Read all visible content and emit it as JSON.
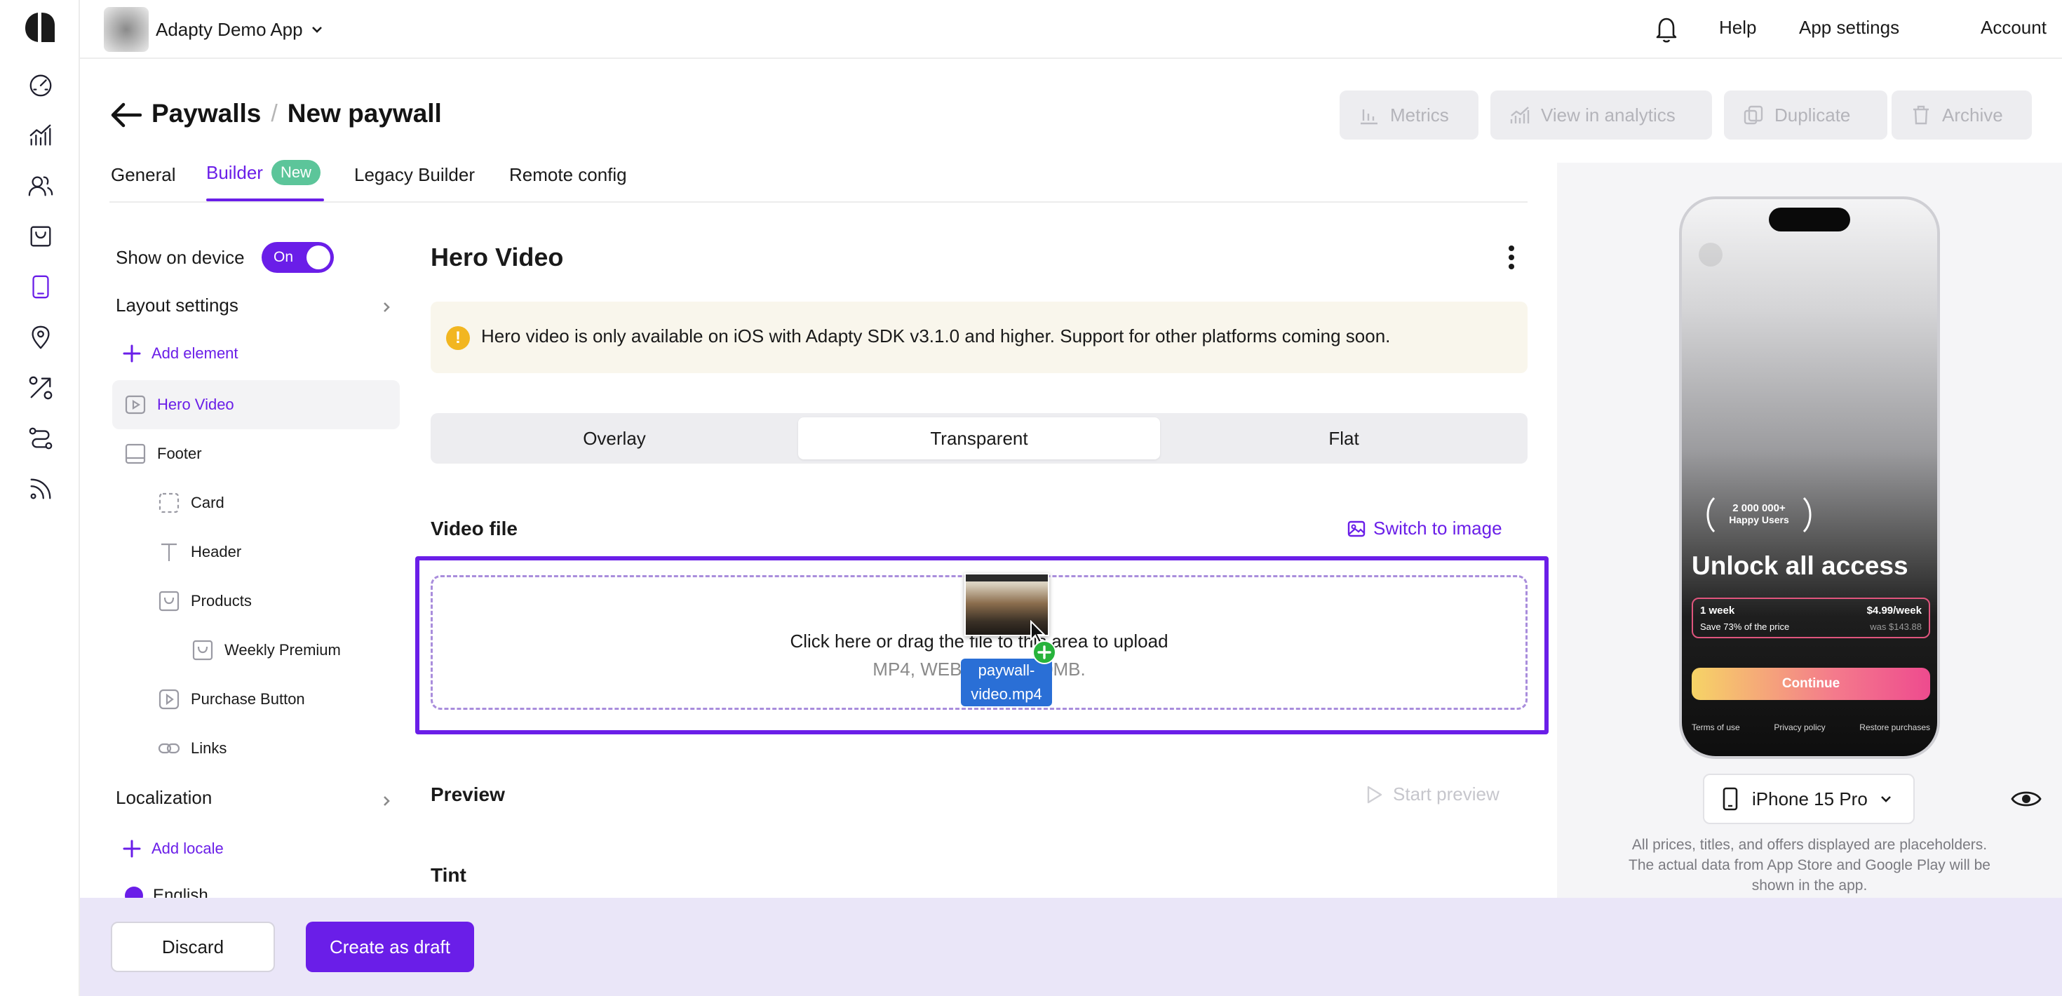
{
  "app": {
    "name": "Adapty Demo App"
  },
  "topbar": {
    "help": "Help",
    "app_settings": "App settings",
    "account": "Account"
  },
  "header": {
    "breadcrumb_root": "Paywalls",
    "separator": "/",
    "title": "New paywall",
    "actions": {
      "metrics": "Metrics",
      "view_analytics": "View in analytics",
      "duplicate": "Duplicate",
      "archive": "Archive"
    }
  },
  "tabs": [
    {
      "label": "General"
    },
    {
      "label": "Builder",
      "badge": "New",
      "active": true
    },
    {
      "label": "Legacy Builder"
    },
    {
      "label": "Remote config"
    }
  ],
  "sidebar": {
    "show_on_device": "Show on device",
    "toggle_label": "On",
    "layout_settings": "Layout settings",
    "add_element": "Add element",
    "items": [
      {
        "label": "Hero Video",
        "icon": "video-icon",
        "active": true
      },
      {
        "label": "Footer",
        "icon": "footer-icon"
      },
      {
        "label": "Card",
        "icon": "card-icon"
      },
      {
        "label": "Header",
        "icon": "text-icon"
      },
      {
        "label": "Products",
        "icon": "products-icon"
      },
      {
        "label": "Weekly Premium",
        "icon": "product-icon"
      },
      {
        "label": "Purchase Button",
        "icon": "play-icon"
      },
      {
        "label": "Links",
        "icon": "link-icon"
      }
    ],
    "localization": "Localization",
    "add_locale": "Add locale",
    "locale_english": "English"
  },
  "editor": {
    "section_title": "Hero Video",
    "warning": "Hero video is only available on iOS with Adapty SDK v3.1.0 and higher. Support for other platforms coming soon.",
    "modes": [
      "Overlay",
      "Transparent",
      "Flat"
    ],
    "active_mode": "Transparent",
    "video_file_label": "Video file",
    "switch_to_image": "Switch to image",
    "upload_main": "Click here or drag the file to this area to upload",
    "upload_hint": "MP4, WEBM, up to 30MB.",
    "drag_file_name": "paywall-video.mp4",
    "preview_label": "Preview",
    "start_preview": "Start preview",
    "tint_label": "Tint"
  },
  "preview": {
    "social_proof_count": "2 000 000+",
    "social_proof_label": "Happy Users",
    "headline": "Unlock all access",
    "product_name": "1 week",
    "product_price": "$4.99/week",
    "product_save": "Save 73% of the price",
    "product_was": "was $143.88",
    "cta": "Continue",
    "links": [
      "Terms of use",
      "Privacy policy",
      "Restore purchases"
    ],
    "device": "iPhone 15 Pro",
    "disclaimer_1": "All prices, titles, and offers displayed are placeholders.",
    "disclaimer_2": "The actual data from App Store and Google Play will be",
    "disclaimer_3": "shown in the app."
  },
  "footer": {
    "discard": "Discard",
    "create_draft": "Create as draft"
  },
  "colors": {
    "accent": "#6a1ee8",
    "warning_bg": "#f9f6ec",
    "badge": "#5cc59a"
  }
}
